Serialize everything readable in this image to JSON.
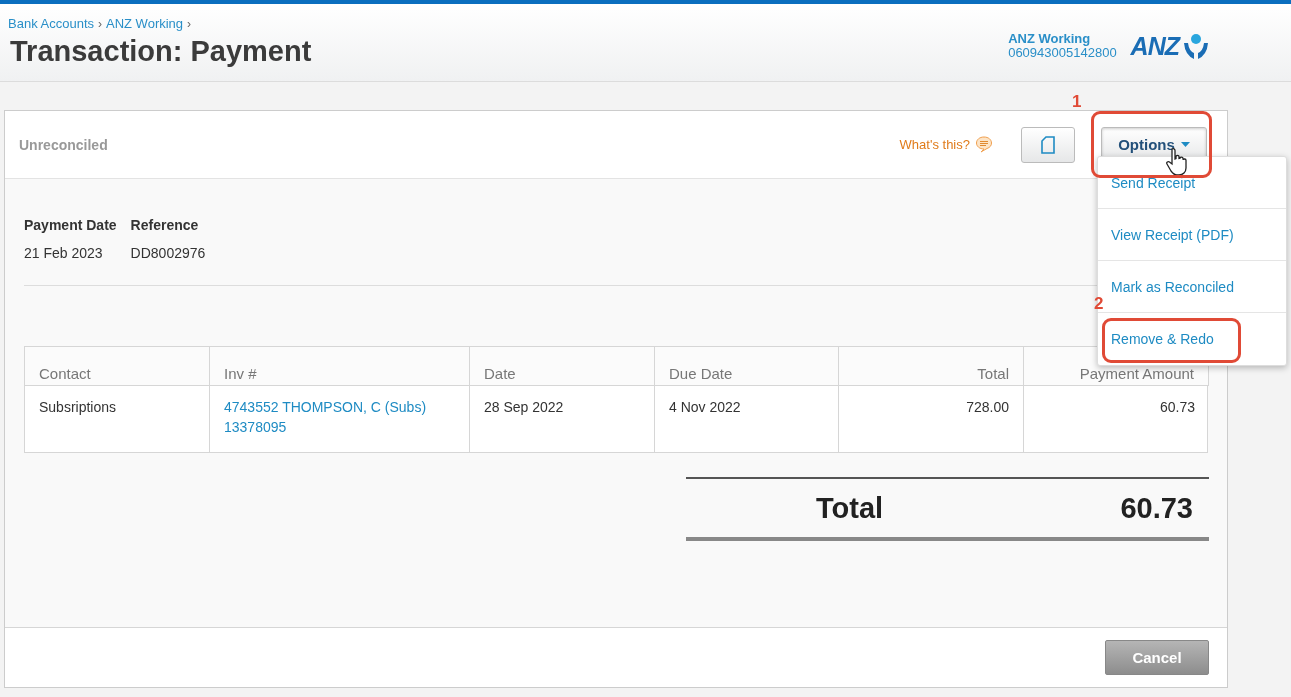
{
  "header": {
    "breadcrumbs": [
      {
        "label": "Bank Accounts",
        "separator": "›"
      },
      {
        "label": "ANZ Working",
        "separator": "›"
      }
    ],
    "title": "Transaction: Payment",
    "account": {
      "name": "ANZ Working",
      "number": "060943005142800"
    },
    "logo": "ANZ"
  },
  "toolbar": {
    "status": "Unreconciled",
    "help_link": "What's this?",
    "options_button": "Options"
  },
  "options_menu": {
    "open": true,
    "items": [
      "Send Receipt",
      "View Receipt (PDF)",
      "Mark as Reconciled",
      "Remove & Redo"
    ]
  },
  "details": {
    "fields": [
      {
        "label": "Payment Date",
        "value": "21 Feb 2023"
      },
      {
        "label": "Reference",
        "value": "DD8002976"
      }
    ]
  },
  "table": {
    "columns": [
      {
        "label": "Contact",
        "kind": "text"
      },
      {
        "label": "Inv #",
        "kind": "text"
      },
      {
        "label": "Date",
        "kind": "text"
      },
      {
        "label": "Due Date",
        "kind": "text"
      },
      {
        "label": "Total",
        "kind": "amount"
      },
      {
        "label": "Payment Amount",
        "kind": "amount"
      }
    ],
    "rows": [
      [
        {
          "text": "Subsriptions",
          "kind": "text"
        },
        {
          "text": "4743552 THOMPSON, C (Subs)\n13378095",
          "kind": "link"
        },
        {
          "text": "28 Sep 2022",
          "kind": "text"
        },
        {
          "text": "4 Nov 2022",
          "kind": "text"
        },
        {
          "text": "728.00",
          "kind": "text"
        },
        {
          "text": "60.73",
          "kind": "text"
        }
      ]
    ]
  },
  "total": {
    "label": "Total",
    "value": "60.73"
  },
  "footer": {
    "cancel_button": "Cancel"
  },
  "annotations": [
    {
      "label": "1"
    },
    {
      "label": "2"
    }
  ]
}
